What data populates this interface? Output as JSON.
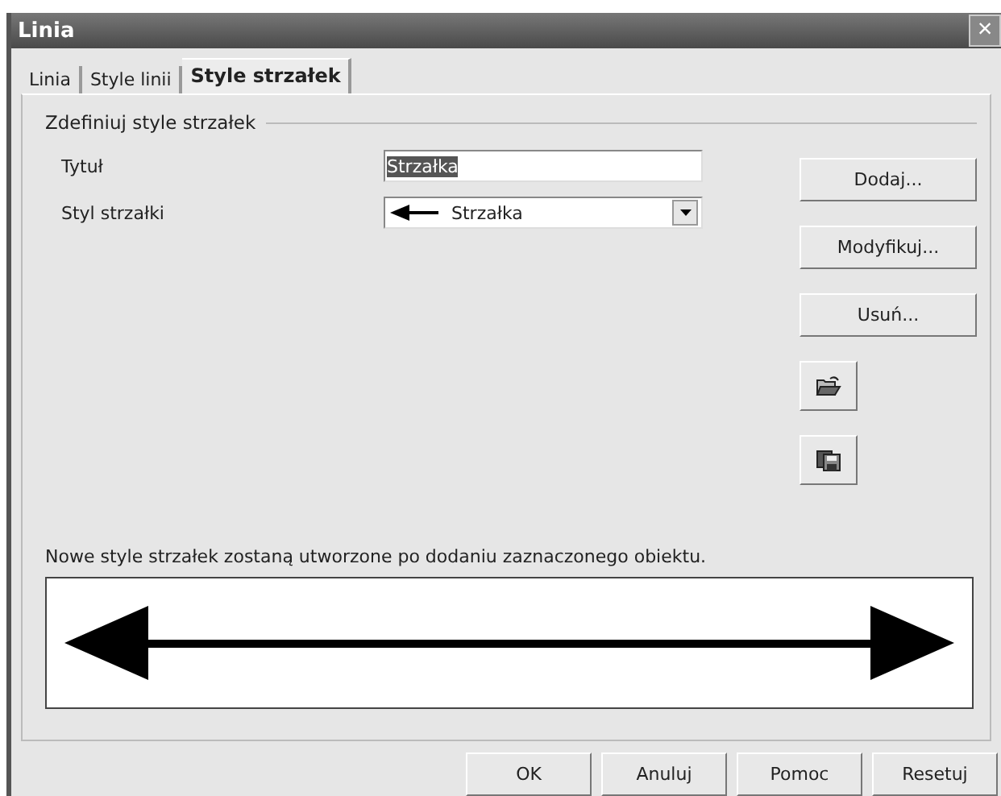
{
  "window": {
    "title": "Linia",
    "close": "×"
  },
  "tabs": [
    {
      "label": "Linia",
      "selected": false
    },
    {
      "label": "Style linii",
      "selected": false
    },
    {
      "label": "Style strzałek",
      "selected": true
    }
  ],
  "group": {
    "title": "Zdefiniuj style strzałek",
    "title_field": {
      "label": "Tytuł",
      "value": "Strzałka"
    },
    "style_field": {
      "label": "Styl strzałki",
      "value": "Strzałka"
    },
    "buttons": [
      "Dodaj...",
      "Modyfikuj...",
      "Usuń..."
    ]
  },
  "note": "Nowe style strzałek zostaną utworzone po dodaniu zaznaczonego obiektu.",
  "footer_buttons": [
    "OK",
    "Anuluj",
    "Pomoc",
    "Resetuj"
  ]
}
